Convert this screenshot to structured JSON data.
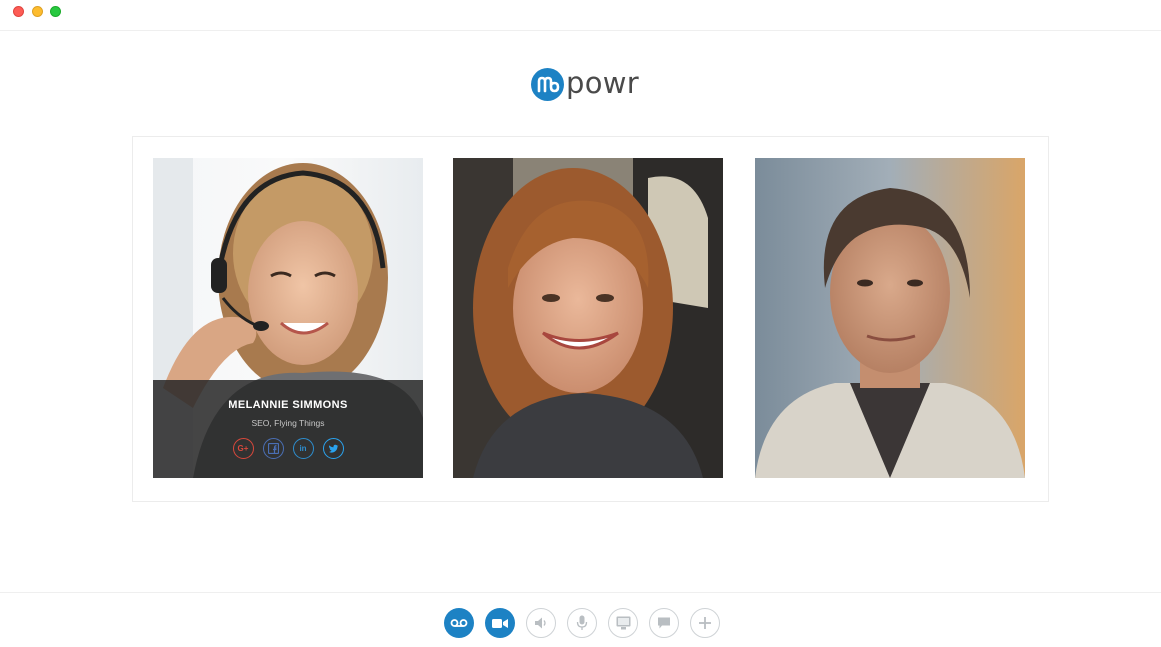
{
  "window": {
    "controls": [
      "close",
      "minimize",
      "maximize"
    ]
  },
  "brand": {
    "logo_text": "powr",
    "logo_icon": "m-logo-icon",
    "accent_color": "#1d82c4"
  },
  "participants": [
    {
      "name": "MELANNIE SIMMONS",
      "role": "SEO, Flying Things",
      "social": [
        {
          "icon": "google-plus-icon",
          "glyph": "G+"
        },
        {
          "icon": "facebook-icon",
          "glyph": "f"
        },
        {
          "icon": "linkedin-icon",
          "glyph": "in"
        },
        {
          "icon": "twitter-icon",
          "glyph": "❧"
        }
      ]
    },
    {
      "photo": "participant-2-video"
    },
    {
      "photo": "participant-3-video"
    }
  ],
  "controls": [
    {
      "icon": "voicemail-icon",
      "state": "active"
    },
    {
      "icon": "video-camera-icon",
      "state": "active"
    },
    {
      "icon": "speaker-icon",
      "state": "inactive"
    },
    {
      "icon": "microphone-icon",
      "state": "inactive"
    },
    {
      "icon": "screen-share-icon",
      "state": "inactive"
    },
    {
      "icon": "chat-icon",
      "state": "inactive"
    },
    {
      "icon": "add-icon",
      "state": "inactive"
    }
  ]
}
